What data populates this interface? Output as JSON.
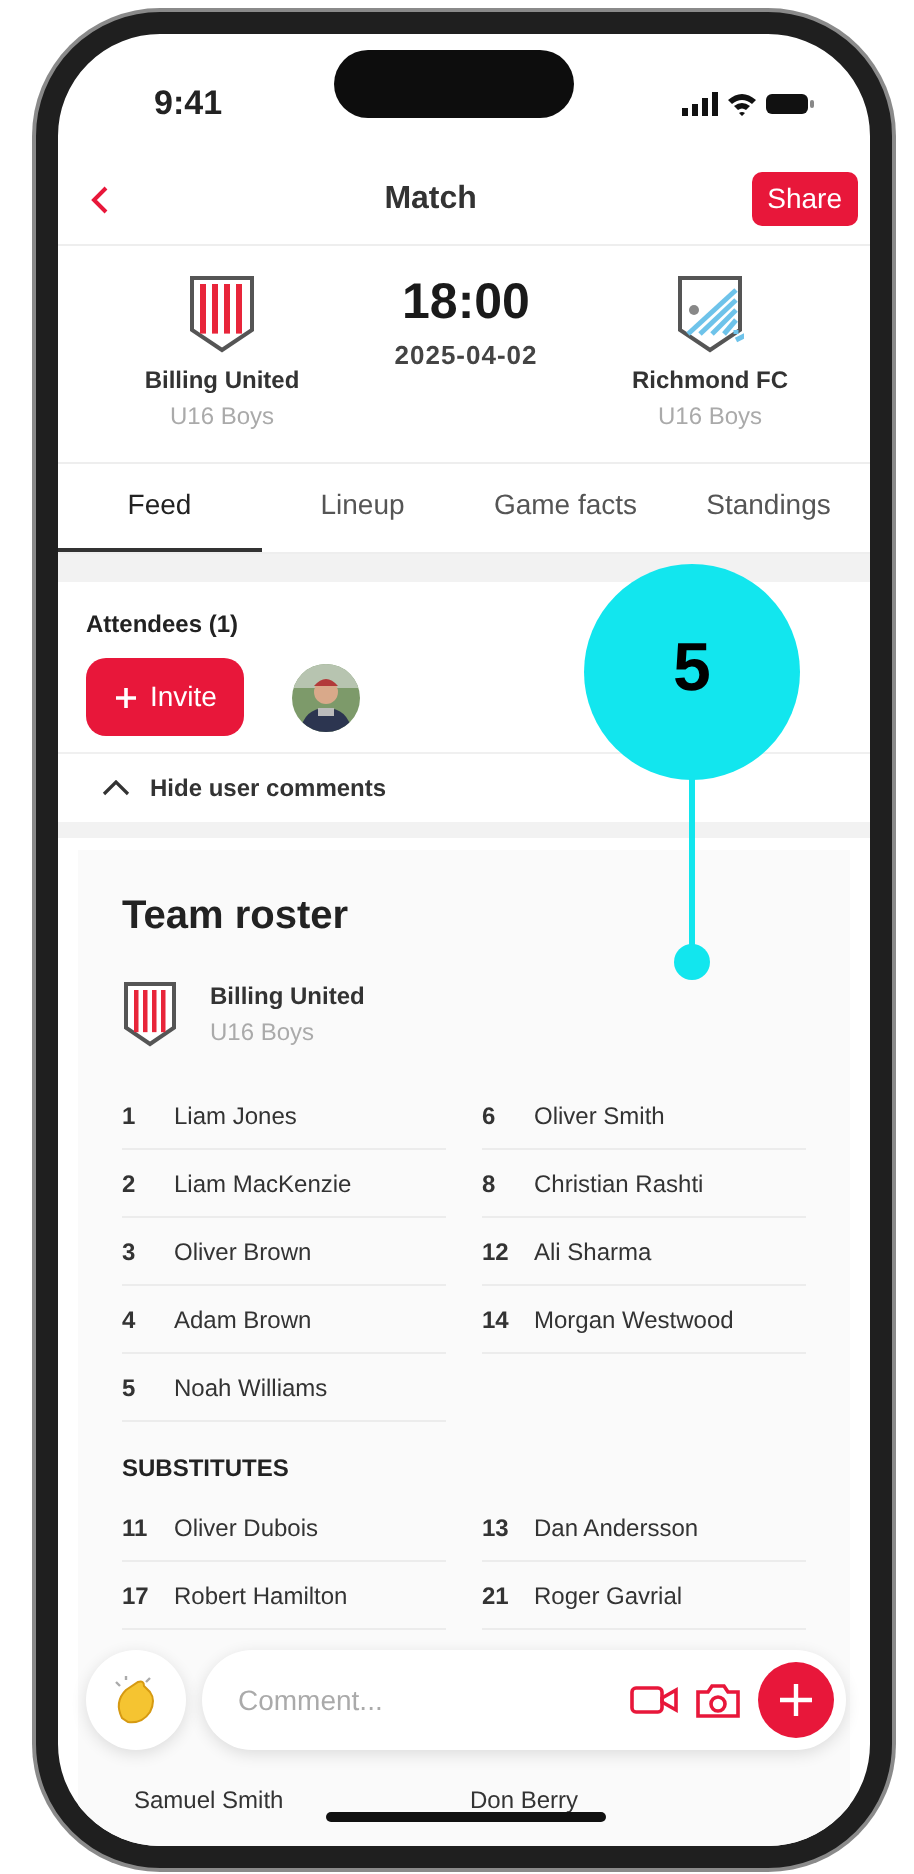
{
  "status_bar": {
    "time": "9:41"
  },
  "header": {
    "title": "Match",
    "share_button": "Share"
  },
  "match": {
    "home": {
      "name": "Billing United",
      "group": "U16 Boys"
    },
    "away": {
      "name": "Richmond FC",
      "group": "U16 Boys"
    },
    "time": "18:00",
    "date": "2025-04-02"
  },
  "tabs": [
    {
      "label": "Feed",
      "selected": true
    },
    {
      "label": "Lineup",
      "selected": false
    },
    {
      "label": "Game facts",
      "selected": false
    },
    {
      "label": "Standings",
      "selected": false
    }
  ],
  "attendees": {
    "label": "Attendees (1)",
    "invite_button": "Invite"
  },
  "comments_toggle": {
    "label": "Hide user comments"
  },
  "roster": {
    "title": "Team roster",
    "team": {
      "name": "Billing United",
      "group": "U16 Boys"
    },
    "starters": [
      {
        "number": "1",
        "name": "Liam Jones"
      },
      {
        "number": "6",
        "name": "Oliver Smith"
      },
      {
        "number": "2",
        "name": "Liam MacKenzie"
      },
      {
        "number": "8",
        "name": "Christian Rashti"
      },
      {
        "number": "3",
        "name": "Oliver Brown"
      },
      {
        "number": "12",
        "name": "Ali Sharma"
      },
      {
        "number": "4",
        "name": "Adam Brown"
      },
      {
        "number": "14",
        "name": "Morgan Westwood"
      },
      {
        "number": "5",
        "name": "Noah Williams"
      }
    ],
    "substitutes_label": "SUBSTITUTES",
    "substitutes": [
      {
        "number": "11",
        "name": "Oliver Dubois"
      },
      {
        "number": "13",
        "name": "Dan Andersson"
      },
      {
        "number": "17",
        "name": "Robert Hamilton"
      },
      {
        "number": "21",
        "name": "Roger Gavrial"
      }
    ],
    "more_names": [
      "Samuel Smith",
      "Don Berry"
    ]
  },
  "comment_bar": {
    "placeholder": "Comment..."
  },
  "callout": {
    "label": "5"
  }
}
